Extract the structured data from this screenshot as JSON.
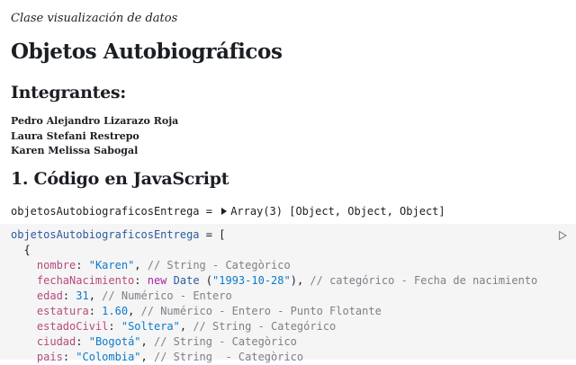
{
  "header": {
    "subtitle": "Clase visualización de datos",
    "title": "Objetos Autobiográficos"
  },
  "members_section": {
    "heading": "Integrantes:",
    "names": [
      "Pedro Alejandro Lizarazo Roja",
      "Laura Stefani Restrepo",
      "Karen Melissa Sabogal"
    ]
  },
  "code_section": {
    "heading": "1. Código en JavaScript"
  },
  "inspector": {
    "variable": "objetosAutobiograficosEntrega",
    "equals": " = ",
    "value": "Array(3) [Object, Object, Object]"
  },
  "code_cell": {
    "run_icon": "play-icon",
    "lines": [
      "objetosAutobiograficosEntrega = [",
      "  {",
      "    nombre: \"Karen\", // String - Categòrico",
      "    fechaNacimiento: new Date (\"1993-10-28\"), // categórico - Fecha de nacimiento",
      "    edad: 31, // Numérico - Entero",
      "    estatura: 1.60, // Numérico - Entero - Punto Flotante",
      "    estadoCivil: \"Soltera\", // String - Categórico",
      "    ciudad: \"Bogotá\", // String - Categòrico",
      "    pais: \"Colombia\", // String  - Categòrico"
    ]
  },
  "colors": {
    "text": "#1b1e23",
    "cell_background": "#f5f5f5",
    "variable": "#2c5b9e",
    "property": "#b64b7c",
    "string": "#0b7acd",
    "keyword": "#a626a4",
    "comment": "#7e7f87"
  }
}
